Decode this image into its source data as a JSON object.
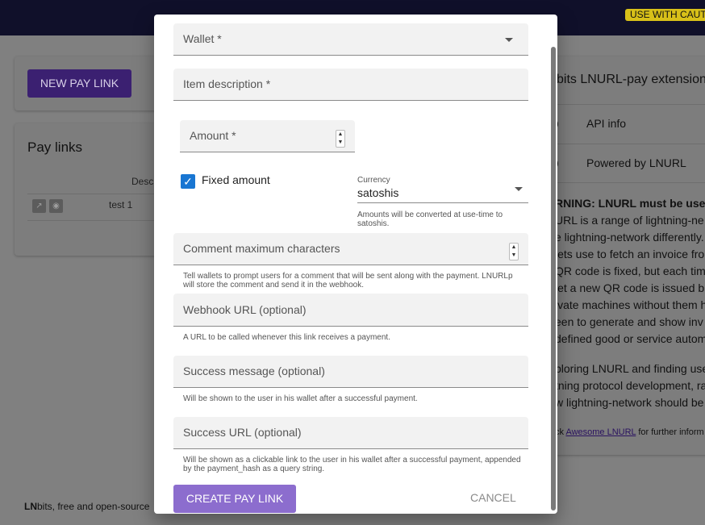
{
  "background": {
    "caution_badge": "USE WITH CAUT",
    "new_pay_link_button": "NEW PAY LINK",
    "pay_links": {
      "title": "Pay links",
      "column_header": "Desc",
      "rows": [
        {
          "description": "test 1"
        }
      ]
    },
    "info_panel": {
      "title": "bits LNURL-pay extension",
      "items": [
        "API info",
        "Powered by LNURL"
      ],
      "text_lines": [
        "RNING: LNURL must be use",
        "URL is a range of lightning-ne",
        "e lightning-network differently.",
        "lets use to fetch an invoice fro",
        "QR code is fixed, but each tim",
        "let a new QR code is issued b",
        "ivate machines without them h",
        "een to generate and show inv",
        "defined good or service autom",
        "",
        "ploring LNURL and finding use",
        "tning protocol development, ra",
        "w lightning-network should be"
      ],
      "footer_prefix": "ck",
      "footer_link": "Awesome LNURL",
      "footer_suffix": "for further inform"
    },
    "footer_bold": "LN",
    "footer_rest": "bits, free and open-source"
  },
  "dialog": {
    "wallet_label": "Wallet *",
    "item_description_label": "Item description *",
    "amount_label": "Amount *",
    "fixed_amount_label": "Fixed amount",
    "fixed_amount_checked": true,
    "currency": {
      "caption": "Currency",
      "value": "satoshis",
      "hint": "Amounts will be converted at use-time to satoshis."
    },
    "comment_label": "Comment maximum characters",
    "comment_hint": "Tell wallets to prompt users for a comment that will be sent along with the payment. LNURLp will store the comment and send it in the webhook.",
    "webhook_label": "Webhook URL (optional)",
    "webhook_hint": "A URL to be called whenever this link receives a payment.",
    "success_message_label": "Success message (optional)",
    "success_message_hint": "Will be shown to the user in his wallet after a successful payment.",
    "success_url_label": "Success URL (optional)",
    "success_url_hint": "Will be shown as a clickable link to the user in his wallet after a successful payment, appended by the payment_hash as a query string.",
    "create_button": "CREATE PAY LINK",
    "cancel_button": "CANCEL"
  },
  "colors": {
    "primary": "#8c6dce",
    "checkbox": "#1976d2",
    "caution": "#d8c019",
    "topbar": "#10102a"
  }
}
